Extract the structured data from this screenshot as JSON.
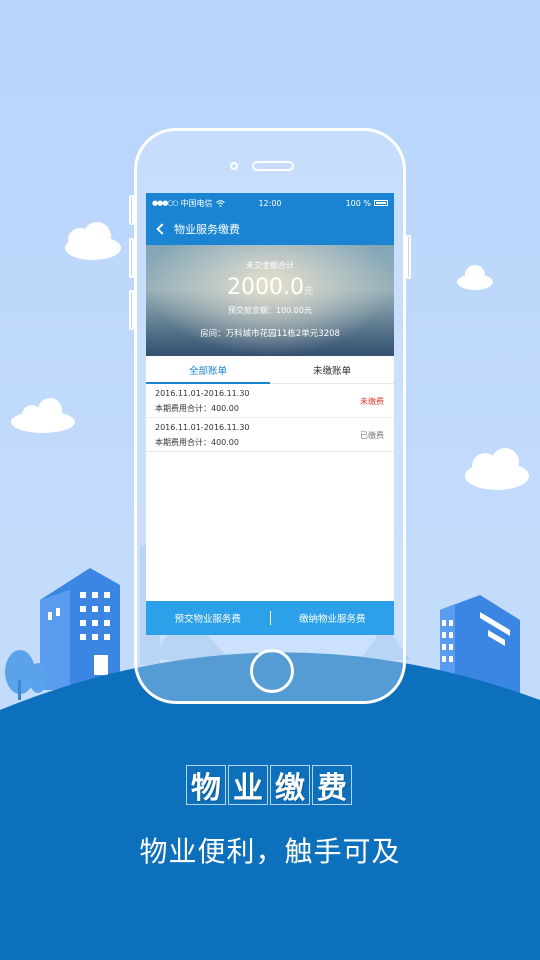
{
  "status_bar": {
    "carrier": "中国电信",
    "time": "12:00",
    "battery": "100 %"
  },
  "nav": {
    "title": "物业服务缴费"
  },
  "summary": {
    "label": "未交金额合计",
    "amount": "2000.0",
    "unit": "元",
    "prepaid": "预交款余额：100.00元",
    "room": "房间：万科城市花园11栋2单元3208"
  },
  "tabs": [
    {
      "label": "全部账单"
    },
    {
      "label": "未缴账单"
    }
  ],
  "bills": [
    {
      "period": "2016.11.01-2016.11.30",
      "total": "本期费用合计：400.00",
      "status": "未缴费"
    },
    {
      "period": "2016.11.01-2016.11.30",
      "total": "本期费用合计：400.00",
      "status": "已缴费"
    }
  ],
  "bottom_bar": {
    "prepay_label": "预交物业服务费",
    "pay_label": "缴纳物业服务费"
  },
  "hero": {
    "title_chars": [
      "物",
      "业",
      "缴",
      "费"
    ],
    "subtitle": "物业便利，触手可及"
  },
  "colors": {
    "primary": "#1a84d3",
    "bottom_button": "#2ca0e8",
    "ground": "#0d70bd",
    "sky": "#bcd7fb",
    "unpaid": "#e03a2e"
  }
}
